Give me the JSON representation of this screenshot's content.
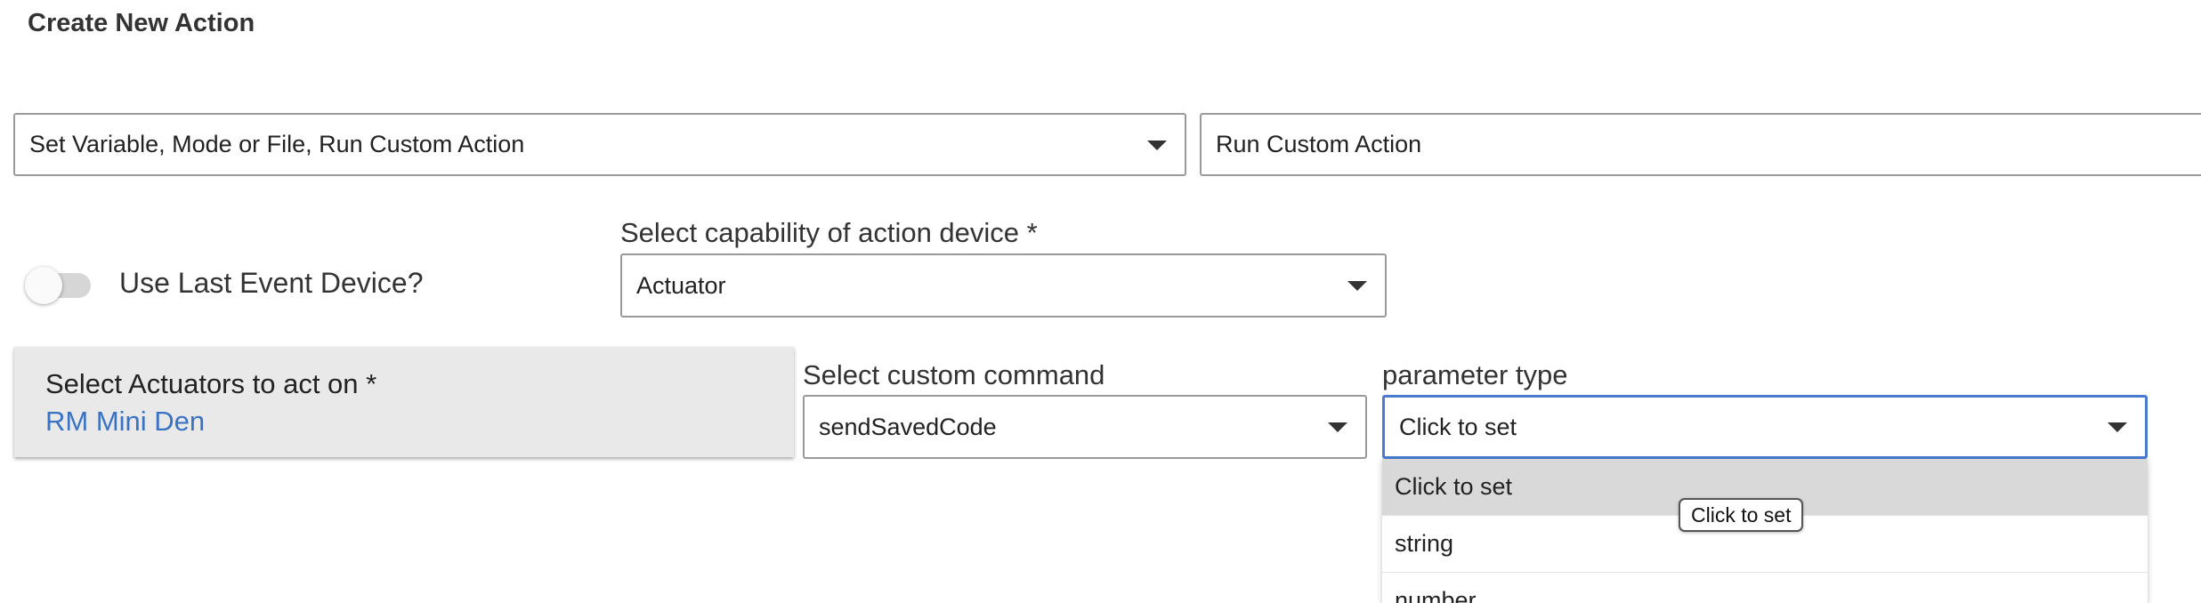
{
  "dialog": {
    "title": "Create New Action"
  },
  "action_category": {
    "selected": "Set Variable, Mode or File, Run Custom Action"
  },
  "action_type": {
    "selected": "Run Custom Action"
  },
  "use_last_event_device": {
    "label": "Use Last Event Device?",
    "enabled": false
  },
  "capability": {
    "label": "Select capability of action device *",
    "selected": "Actuator"
  },
  "actuators": {
    "label": "Select Actuators to act on *",
    "value": "RM Mini Den"
  },
  "custom_command": {
    "label": "Select custom command",
    "selected": "sendSavedCode"
  },
  "parameter_type": {
    "label": "parameter type",
    "selected": "Click to set",
    "options": [
      "Click to set",
      "string",
      "number"
    ],
    "tooltip": "Click to set"
  },
  "colors": {
    "accent": "#3a72c4",
    "focus_border": "#4a7bd0",
    "card_bg": "#e9e9e9",
    "selected_option_bg": "#d9d9d9"
  }
}
